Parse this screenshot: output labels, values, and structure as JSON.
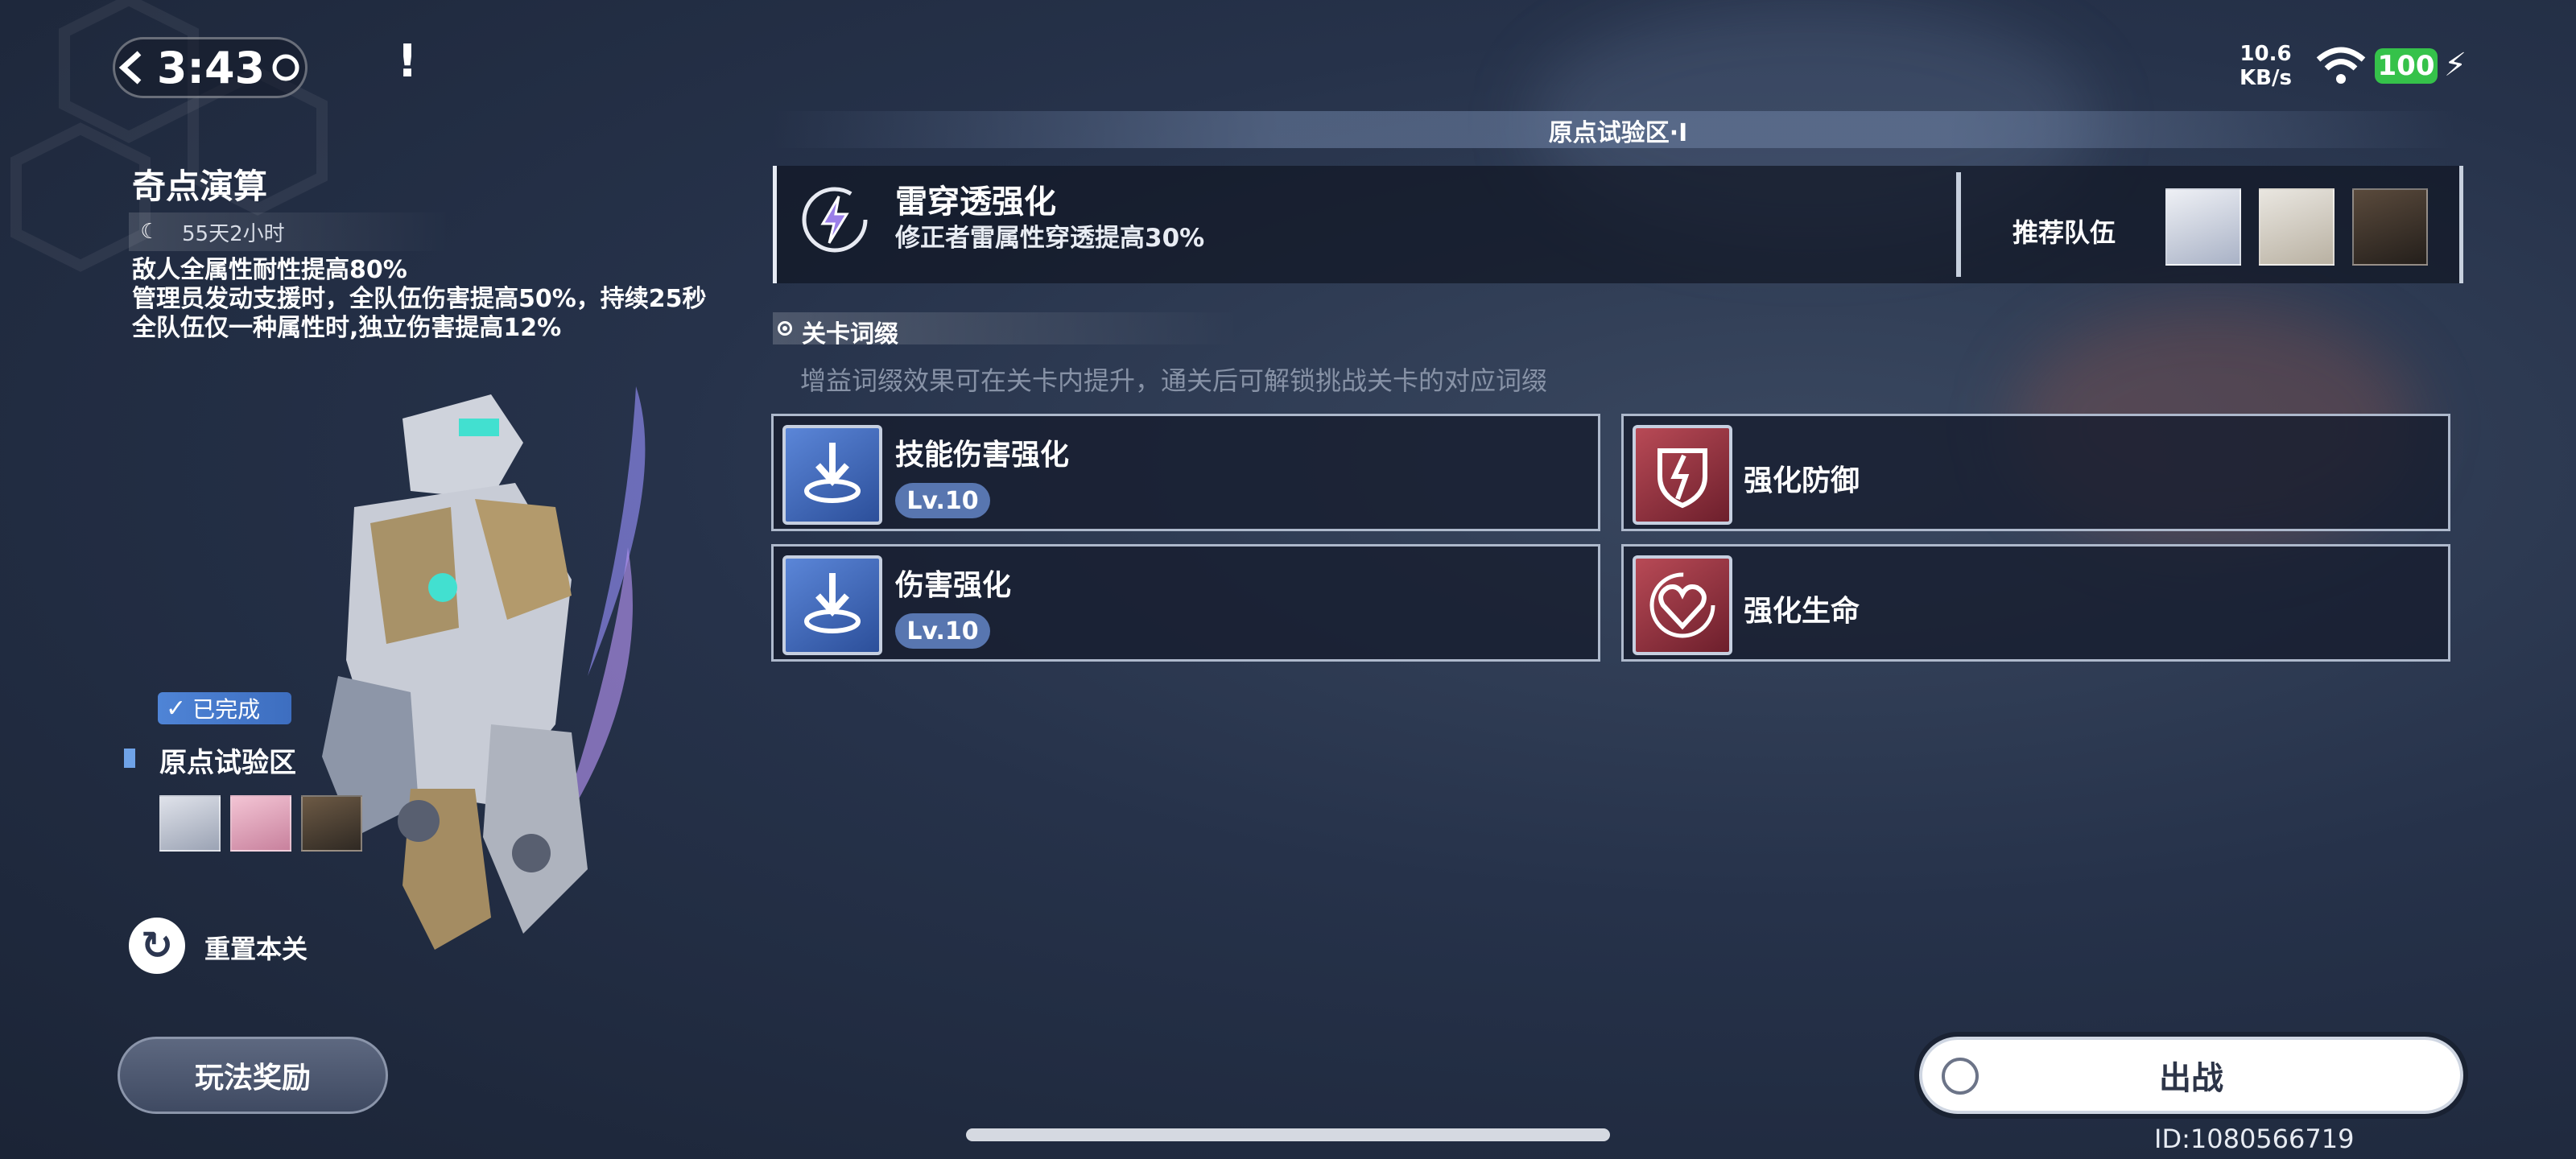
{
  "status_bar": {
    "time": "3:43",
    "alert": "!",
    "net_speed_value": "10.6",
    "net_speed_unit": "KB/s",
    "battery": "100"
  },
  "left_panel": {
    "title": "奇点演算",
    "timer": "55天2小时",
    "descriptions": [
      "敌人全属性耐性提高80%",
      "管理员发动支援时，全队伍伤害提高50%，持续25秒",
      "全队伍仅一种属性时,独立伤害提高12%"
    ],
    "completed_badge": "已完成",
    "zone_name": "原点试验区",
    "reset_label": "重置本关",
    "reward_button": "玩法奖励"
  },
  "stage": {
    "title": "原点试验区·Ⅰ",
    "effect_title": "雷穿透强化",
    "effect_desc": "修正者雷属性穿透提高30%",
    "recommended_label": "推荐队伍"
  },
  "affix": {
    "label": "关卡词缀",
    "note": "增益词缀效果可在关卡内提升，通关后可解锁挑战关卡的对应词缀",
    "buffs": [
      {
        "name": "技能伤害强化",
        "level": "Lv.10",
        "color": "blue",
        "icon": "download-arrow-icon"
      },
      {
        "name": "强化防御",
        "level": "",
        "color": "red",
        "icon": "shield-break-icon"
      },
      {
        "name": "伤害强化",
        "level": "Lv.10",
        "color": "blue",
        "icon": "download-arrow-icon"
      },
      {
        "name": "强化生命",
        "level": "",
        "color": "red",
        "icon": "heart-icon"
      }
    ]
  },
  "sortie_button": "出战",
  "uid": "ID:1080566719",
  "colors": {
    "accent_blue": "#5876b0",
    "buff_red": "#b84a56",
    "battery_green": "#35c24a"
  }
}
